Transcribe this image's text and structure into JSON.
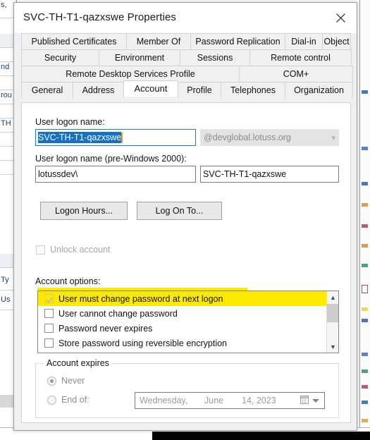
{
  "window": {
    "title": "SVC-TH-T1-qazxswe Properties",
    "close_icon": "close-icon"
  },
  "tabs": {
    "row1": [
      "Published Certificates",
      "Member Of",
      "Password Replication",
      "Dial-in",
      "Object"
    ],
    "row2": [
      "Security",
      "Environment",
      "Sessions",
      "Remote control"
    ],
    "row3": [
      "Remote Desktop Services Profile",
      "COM+"
    ],
    "row4": [
      "General",
      "Address",
      "Account",
      "Profile",
      "Telephones",
      "Organization"
    ],
    "active": "Account"
  },
  "account": {
    "logon_name_label": "User logon name:",
    "logon_name_value": "SVC-TH-T1-qazxswe",
    "upn_suffix": "@devglobal.lotuss.org",
    "upn_arrow": "chevron-down-icon",
    "pre2000_label": "User logon name (pre-Windows 2000):",
    "pre2000_domain": "lotussdev\\",
    "pre2000_value": "SVC-TH-T1-qazxswe",
    "logon_hours_button": "Logon Hours...",
    "log_on_to_button": "Log On To...",
    "unlock_account_label": "Unlock account",
    "options_label": "Account options:",
    "options": [
      {
        "label": "User must change password at next logon",
        "checked": true,
        "highlighted": true
      },
      {
        "label": "User cannot change password",
        "checked": false,
        "highlighted": false
      },
      {
        "label": "Password never expires",
        "checked": false,
        "highlighted": false
      },
      {
        "label": "Store password using reversible encryption",
        "checked": false,
        "highlighted": false
      }
    ],
    "scroll_up_icon": "chevron-up-icon",
    "scroll_down_icon": "chevron-down-icon"
  },
  "expires": {
    "group_title": "Account expires",
    "never_label": "Never",
    "end_of_label": "End of:",
    "date_weekday": "Wednesday,",
    "date_month": "June",
    "date_day": "14, 2023",
    "calendar_icon": "calendar-icon",
    "dropdown_icon": "chevron-down-icon",
    "selected": "Never"
  },
  "background": {
    "left_fragments": [
      "nd",
      "rou",
      "TH"
    ],
    "left_lower_fragments": [
      "Ty",
      "Us"
    ],
    "corner_fragment": "s,"
  },
  "colors": {
    "highlight_yellow": "#ffe900",
    "selection_blue": "#1670c9",
    "caret_orange": "#e8962f",
    "dialog_face": "#f0f0f0"
  }
}
